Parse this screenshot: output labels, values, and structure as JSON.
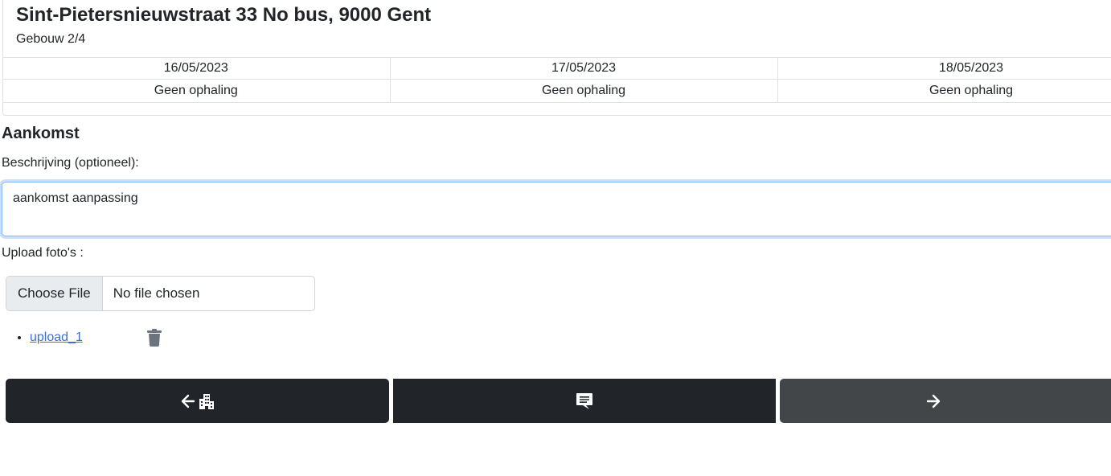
{
  "header": {
    "address": "Sint-Pietersnieuwstraat 33 No bus, 9000 Gent",
    "building": "Gebouw 2/4"
  },
  "schedule": {
    "columns": [
      {
        "date": "16/05/2023",
        "status": "Geen ophaling"
      },
      {
        "date": "17/05/2023",
        "status": "Geen ophaling"
      },
      {
        "date": "18/05/2023",
        "status": "Geen ophaling"
      }
    ]
  },
  "form": {
    "section_title": "Aankomst",
    "description_label": "Beschrijving (optioneel):",
    "description_value": "aankomst aanpassing",
    "upload_label": "Upload foto's :",
    "file_button": "Choose File",
    "file_status": "No file chosen",
    "uploads": [
      {
        "name": "upload_1",
        "delete_icon": "trash-icon"
      }
    ]
  },
  "navigation": {
    "back_icons": [
      "arrow-left-icon",
      "building-icon"
    ],
    "comment_icon": "comment-icon",
    "next_icon": "arrow-right-icon"
  },
  "colors": {
    "dark_button": "#212529",
    "next_button": "#424649",
    "link": "#3a6fd8",
    "focus_border": "#86b7fe"
  }
}
